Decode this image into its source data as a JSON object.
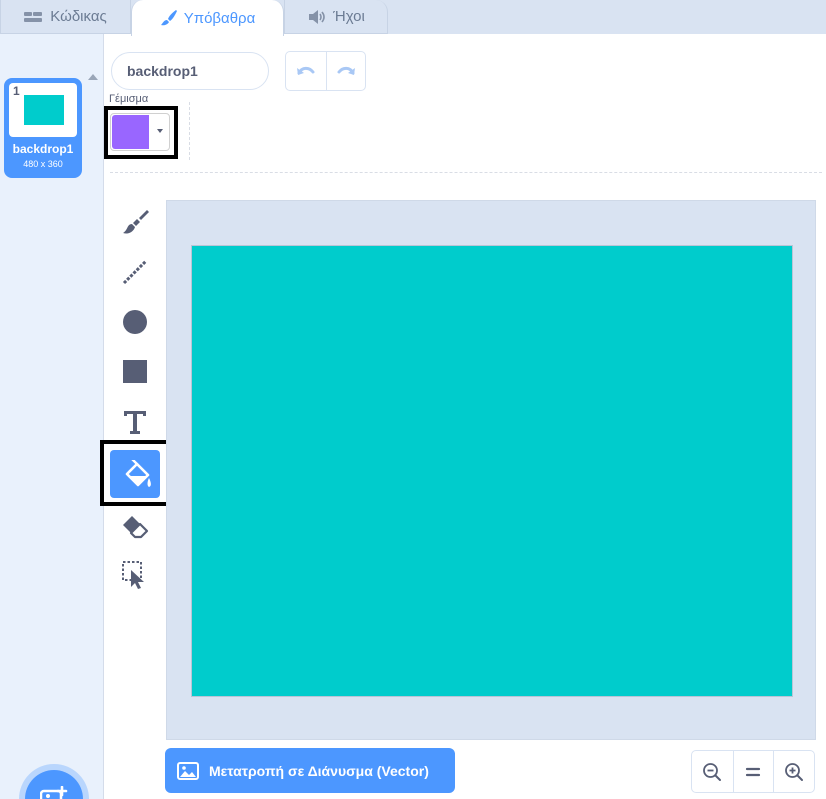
{
  "tabs": {
    "code": {
      "label": "Κώδικας",
      "icon": "code-icon"
    },
    "backdrops": {
      "label": "Υπόβαθρα",
      "icon": "brush-icon"
    },
    "sounds": {
      "label": "Ήχοι",
      "icon": "speaker-icon"
    }
  },
  "backdrop_list": {
    "items": [
      {
        "number": "1",
        "name": "backdrop1",
        "size": "480 x 360",
        "thumb_color": "#00cccc",
        "selected": true
      }
    ],
    "add_button": {
      "icon": "add-backdrop-icon"
    }
  },
  "editor": {
    "name_value": "backdrop1",
    "undo_icon": "undo-icon",
    "redo_icon": "redo-icon",
    "fill": {
      "label": "Γέμισμα",
      "color": "#9966ff"
    },
    "tools": [
      {
        "name": "brush",
        "icon": "brush-tool-icon",
        "active": false
      },
      {
        "name": "line",
        "icon": "line-tool-icon",
        "active": false
      },
      {
        "name": "circle",
        "icon": "circle-tool-icon",
        "active": false
      },
      {
        "name": "rectangle",
        "icon": "rectangle-tool-icon",
        "active": false
      },
      {
        "name": "text",
        "icon": "text-tool-icon",
        "active": false
      },
      {
        "name": "fill",
        "icon": "fill-bucket-icon",
        "active": true
      },
      {
        "name": "eraser",
        "icon": "eraser-tool-icon",
        "active": false
      },
      {
        "name": "select",
        "icon": "select-tool-icon",
        "active": false
      }
    ],
    "canvas_color": "#00cccc",
    "convert_button": {
      "label": "Μετατροπή σε Διάνυσμα (Vector)",
      "icon": "image-icon"
    },
    "zoom": {
      "out_icon": "zoom-out-icon",
      "reset_icon": "zoom-reset-icon",
      "in_icon": "zoom-in-icon"
    }
  },
  "colors": {
    "accent": "#4c97ff",
    "panel": "#e9f1fc",
    "text": "#575e75"
  }
}
